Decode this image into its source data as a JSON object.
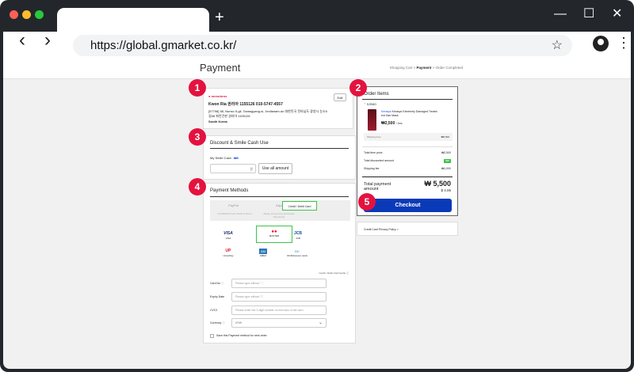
{
  "browser": {
    "new_tab_symbol": "+",
    "minimize_symbol": "—",
    "maximize_symbol": "☐",
    "close_symbol": "✕",
    "back_symbol": "‹",
    "forward_symbol": "›",
    "url": "https://global.gmarket.co.kr/",
    "bookmark_symbol": "☆",
    "menu_symbol": "⋮",
    "dot_colors": [
      "#ff5f56",
      "#ffbd2e",
      "#27c93f"
    ]
  },
  "header": {
    "title": "Payment",
    "breadcrumb": {
      "step1": "Shopping Cart",
      "sep": ">",
      "step2": "Payment",
      "step3": "Order Completed"
    }
  },
  "badges": [
    "1",
    "2",
    "3",
    "4",
    "5"
  ],
  "address": {
    "brand": "mreorkrns",
    "edit_label": "Edit",
    "name_line": "Kwon Ria 권리아 1155126 010-5747-4557",
    "address_line1": "[57798] 58, Nunso 5-gil, Gwangyang-si, Jeollanam-do 대한민국 전라남도 광양시 눈소5",
    "address_line2": "길58 파란건판 권리아 1155126",
    "country": "South Korea"
  },
  "discount": {
    "title": "Discount & Smile Cash Use",
    "smile_cash_label": "My Smile Cash",
    "smile_cash_value": "₩0",
    "currency_suffix": "원",
    "use_all_label": "Use all amount"
  },
  "payment_methods": {
    "title": "Payment Methods",
    "tabs": [
      {
        "label": "PayPal",
        "sub": "Credit/Debit Card, Bank & Direct"
      },
      {
        "label": "Alipay",
        "sub": "Alipay, Hong Kong (Overseas Payments)"
      },
      {
        "label": "Credit / Debit Card",
        "sub": ""
      }
    ],
    "cards": [
      {
        "logo": "VISA",
        "name": "VISA"
      },
      {
        "logo": "●●",
        "name": "MASTER"
      },
      {
        "logo": "JCB",
        "name": "JCB"
      },
      {
        "logo": "UP",
        "name": "UnionPay"
      },
      {
        "logo": "AM",
        "name": "AMEX"
      },
      {
        "logo": "DC",
        "name": "DCI(Discover card)"
      }
    ],
    "card_guide": "Credit / Debit Card Guide",
    "fields": [
      {
        "label": "Card No",
        "placeholder": "Please type without \"-\"."
      },
      {
        "label": "Expiry Date",
        "placeholder": "Please type without \"/\"."
      },
      {
        "label": "CVC2",
        "placeholder": "Please enter the 3-digit number on the back of the card."
      },
      {
        "label": "Currency",
        "placeholder": "KRW"
      }
    ],
    "save_label": "Save this Payment method for next order."
  },
  "order": {
    "title": "Order Items",
    "seller": "SJSMG",
    "product_brand": "Kerasys",
    "product_name_line1": "Kerasys Extremely Damaged Treatm",
    "product_name_line2": "ent Hair Mask",
    "price": "₩2,500",
    "quantity": "/ 1ea",
    "shipping_fee_label": "Shipping Fee",
    "shipping_fee_value": "₩0,000",
    "total_price_label": "Total item price",
    "total_price_value": "₩2,500",
    "discount_label": "Total discounted amount",
    "discount_value": "-₩0",
    "shipping_label": "Shipping fee",
    "shipping_value": "₩1,000",
    "total_payment_label_line1": "Total payment",
    "total_payment_label_line2": "amount",
    "total_payment_value": "₩ 5,500",
    "total_payment_usd": "$ 4.06",
    "checkout_label": "Checkout",
    "privacy_label": "Credit Card Privacy Policy >"
  }
}
